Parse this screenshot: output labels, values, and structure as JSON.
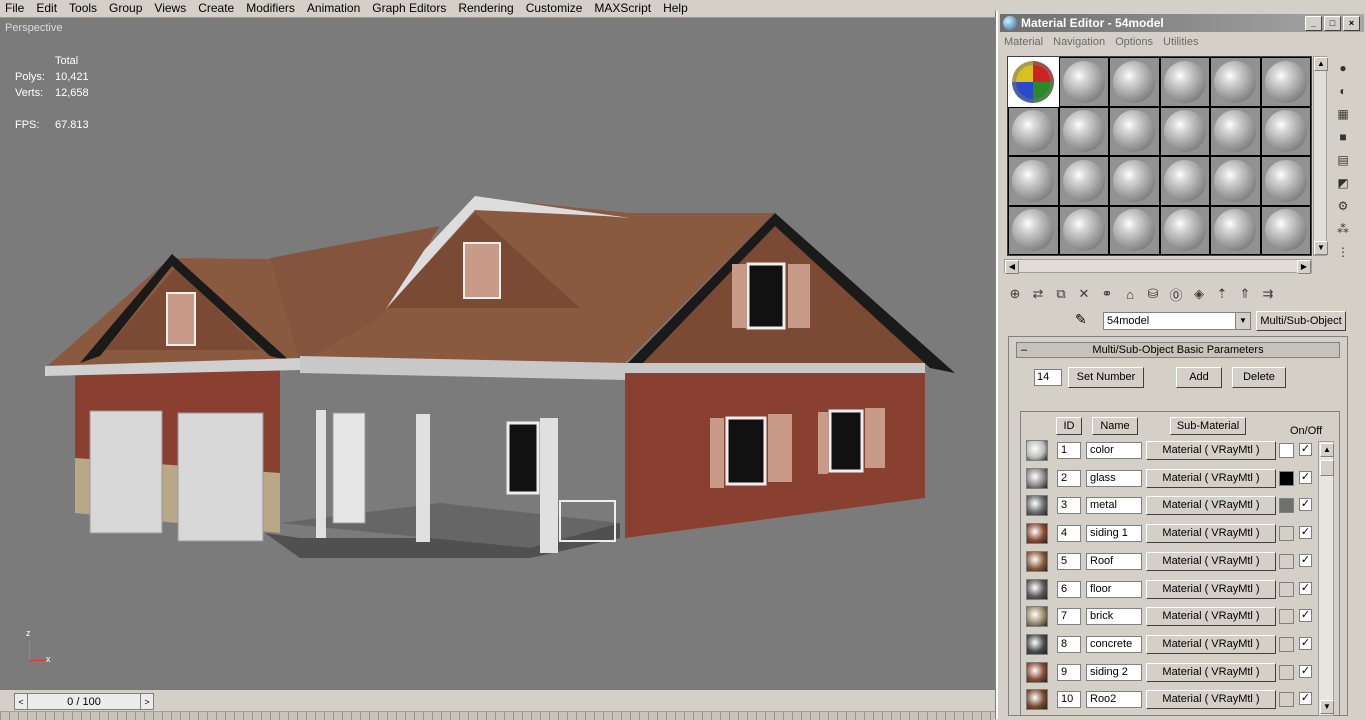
{
  "menu": [
    "File",
    "Edit",
    "Tools",
    "Group",
    "Views",
    "Create",
    "Modifiers",
    "Animation",
    "Graph Editors",
    "Rendering",
    "Customize",
    "MAXScript",
    "Help"
  ],
  "viewport": {
    "label": "Perspective",
    "stats": {
      "total_label": "Total",
      "polys_label": "Polys:",
      "polys": "10,421",
      "verts_label": "Verts:",
      "verts": "12,658",
      "fps_label": "FPS:",
      "fps": "67.813"
    },
    "axis": {
      "z": "z",
      "x": "x"
    }
  },
  "timeline": {
    "value": "0 / 100",
    "prev": "<",
    "next": ">"
  },
  "material_editor": {
    "title": "Material Editor - 54model",
    "menu": [
      "Material",
      "Navigation",
      "Options",
      "Utilities"
    ],
    "material_name": "54model",
    "material_type": "Multi/Sub-Object",
    "rollout_title": "Multi/Sub-Object Basic Parameters",
    "count": "14",
    "set_number": "Set Number",
    "add": "Add",
    "delete": "Delete",
    "headers": {
      "id": "ID",
      "name": "Name",
      "sub": "Sub-Material",
      "onoff": "On/Off"
    },
    "rows": [
      {
        "id": "1",
        "name": "color",
        "sub": "Material ( VRayMtl )",
        "swatch": "#bdbdbd",
        "color": "#ffffff"
      },
      {
        "id": "2",
        "name": "glass",
        "sub": "Material ( VRayMtl )",
        "swatch": "#8a8a8a",
        "color": "#000000"
      },
      {
        "id": "3",
        "name": "metal",
        "sub": "Material ( VRayMtl )",
        "swatch": "#6a6a6a",
        "color": "#707070"
      },
      {
        "id": "4",
        "name": "siding 1",
        "sub": "Material ( VRayMtl )",
        "swatch": "#8a4a30",
        "color": "#d4d0c8"
      },
      {
        "id": "5",
        "name": "Roof",
        "sub": "Material ( VRayMtl )",
        "swatch": "#8a5a3a",
        "color": "#d4d0c8"
      },
      {
        "id": "6",
        "name": "floor",
        "sub": "Material ( VRayMtl )",
        "swatch": "#5a5a5a",
        "color": "#d4d0c8"
      },
      {
        "id": "7",
        "name": "brick",
        "sub": "Material ( VRayMtl )",
        "swatch": "#9a8a6a",
        "color": "#d4d0c8"
      },
      {
        "id": "8",
        "name": "concrete",
        "sub": "Material ( VRayMtl )",
        "swatch": "#4a4a4a",
        "color": "#d4d0c8"
      },
      {
        "id": "9",
        "name": "siding 2",
        "sub": "Material ( VRayMtl )",
        "swatch": "#8a4a34",
        "color": "#d4d0c8"
      },
      {
        "id": "10",
        "name": "Roo2",
        "sub": "Material ( VRayMtl )",
        "swatch": "#7a4a30",
        "color": "#d4d0c8"
      }
    ]
  }
}
